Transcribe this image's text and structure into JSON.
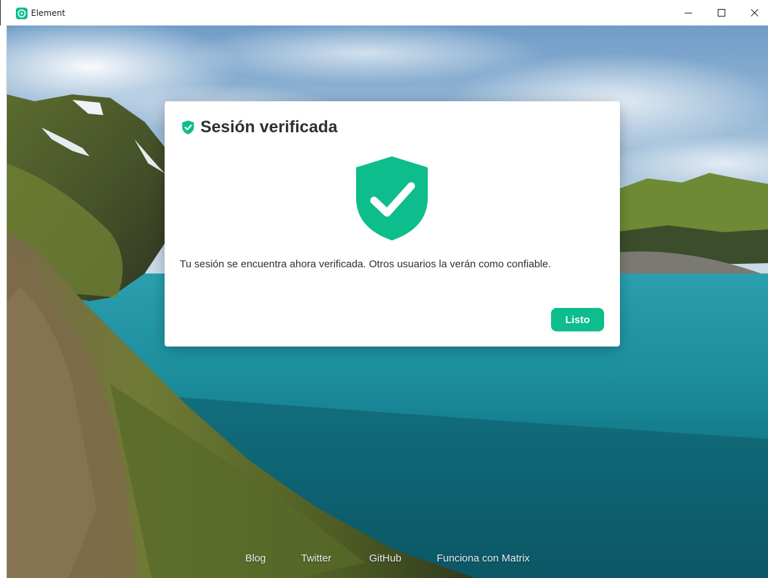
{
  "window": {
    "title": "Element",
    "minimize_icon": "minimize-icon",
    "maximize_icon": "maximize-icon",
    "close_icon": "close-icon"
  },
  "dialog": {
    "title": "Sesión verificada",
    "title_icon": "shield-check-icon",
    "illustration_icon": "large-shield-check-icon",
    "message": "Tu sesión se encuentra ahora verificada. Otros usuarios la verán como confiable.",
    "done_button": "Listo"
  },
  "footer": {
    "links": [
      "Blog",
      "Twitter",
      "GitHub",
      "Funciona con Matrix"
    ]
  },
  "colors": {
    "accent": "#0dbd8b",
    "text": "#2e2f32"
  }
}
